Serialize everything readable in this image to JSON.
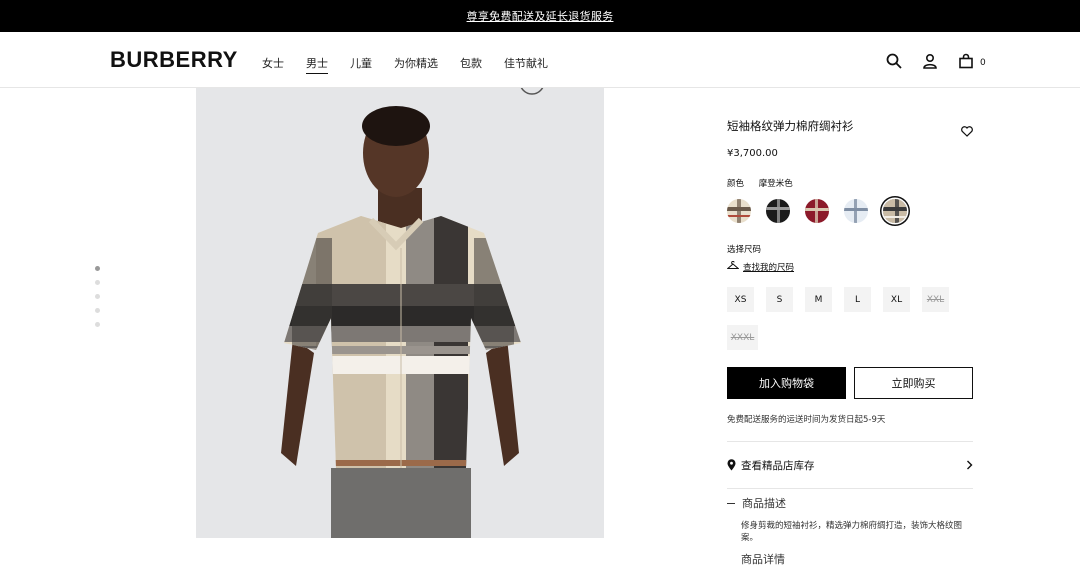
{
  "promo": {
    "text": "尊享免费配送及延长退货服务"
  },
  "header": {
    "logo": "BURBERRY",
    "nav": [
      "女士",
      "男士",
      "儿童",
      "为你精选",
      "包款",
      "佳节献礼"
    ],
    "active_nav": "男士",
    "bag_count": "0"
  },
  "gallery": {
    "dots": 5,
    "active_dot": 0
  },
  "product": {
    "title": "短袖格纹弹力棉府绸衬衫",
    "price": "¥3,700.00",
    "color_label": "颜色",
    "color_value": "摩登米色",
    "swatches": [
      {
        "name": "beige-check",
        "base": "#e9dfcc",
        "stripe": "#6b5a4a"
      },
      {
        "name": "black-check",
        "base": "#1b1b1b",
        "stripe": "#9a9a9a"
      },
      {
        "name": "red-check",
        "base": "#8c1a2a",
        "stripe": "#d9c7b0"
      },
      {
        "name": "pale-blue-check",
        "base": "#e6ecf3",
        "stripe": "#7f8ea3"
      },
      {
        "name": "archive-beige-check",
        "base": "#c9bba5",
        "stripe": "#3a3a3a"
      }
    ],
    "selected_swatch": 4,
    "size_label": "选择尺码",
    "size_finder": "查找我的尺码",
    "sizes": [
      {
        "label": "XS",
        "available": true
      },
      {
        "label": "S",
        "available": true
      },
      {
        "label": "M",
        "available": true
      },
      {
        "label": "L",
        "available": true
      },
      {
        "label": "XL",
        "available": true
      },
      {
        "label": "XXL",
        "available": false
      },
      {
        "label": "XXXL",
        "available": false
      }
    ],
    "add_to_bag": "加入购物袋",
    "buy_now": "立即购买",
    "shipping_note": "免费配送服务的运送时间为发货日起5-9天",
    "store_stock": "查看精品店库存",
    "description_heading": "商品描述",
    "description_text": "修身剪裁的短袖衬衫，精选弹力棉府绸打造，装饰大格纹图案。",
    "details_heading": "商品详情"
  },
  "colors": {
    "accent": "#000000",
    "muted": "#f3f3f3",
    "photo_bg": "#e5e6e8"
  }
}
